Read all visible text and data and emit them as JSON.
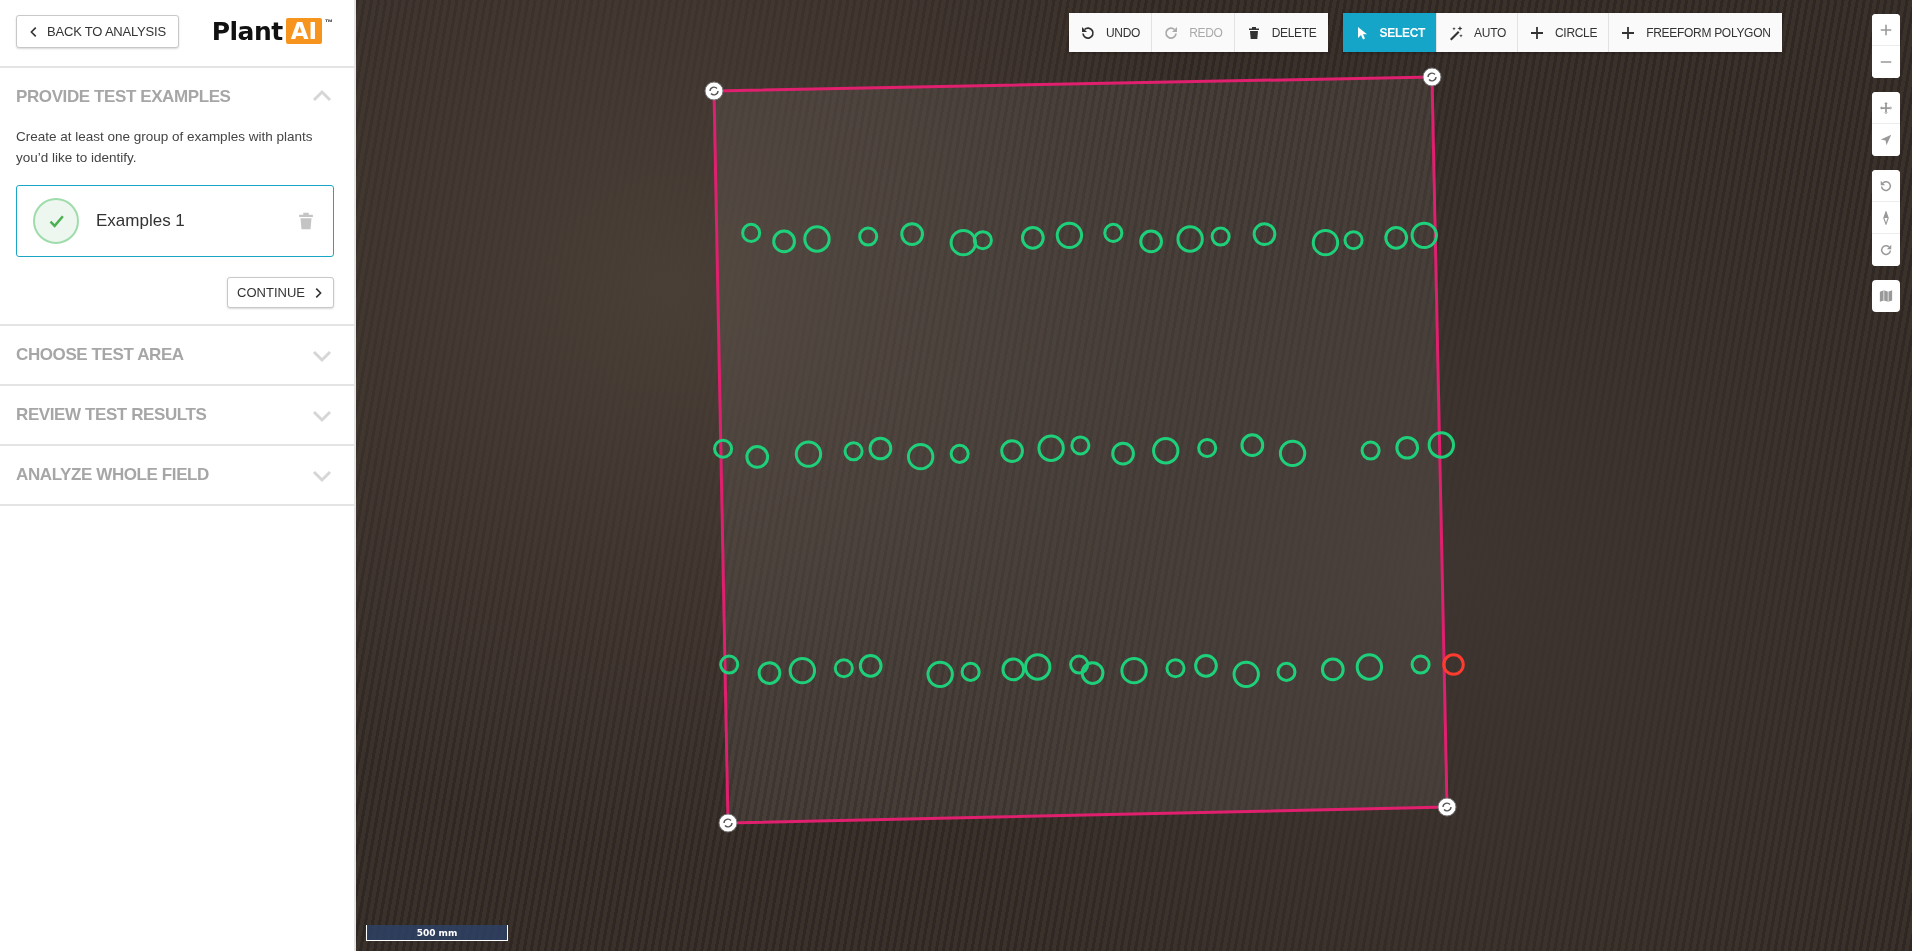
{
  "back_button": {
    "label": "BACK TO ANALYSIS"
  },
  "logo": {
    "word": "Plant",
    "badge": "AI",
    "trademark": "™"
  },
  "steps": [
    {
      "title": "PROVIDE TEST EXAMPLES",
      "expanded": true,
      "description": "Create at least one group of examples with plants you’d like to identify.",
      "groups": [
        {
          "name": "Examples 1",
          "complete": true
        }
      ],
      "continue_label": "CONTINUE"
    },
    {
      "title": "CHOOSE TEST AREA",
      "expanded": false
    },
    {
      "title": "REVIEW TEST RESULTS",
      "expanded": false
    },
    {
      "title": "ANALYZE WHOLE FIELD",
      "expanded": false
    }
  ],
  "toolbar": {
    "actions": [
      {
        "kind": "undo",
        "label": "UNDO",
        "disabled": false
      },
      {
        "kind": "redo",
        "label": "REDO",
        "disabled": true
      },
      {
        "kind": "delete",
        "label": "DELETE",
        "disabled": false
      }
    ],
    "modes": [
      {
        "kind": "select",
        "label": "SELECT",
        "selected": true
      },
      {
        "kind": "auto",
        "label": "AUTO",
        "selected": false
      },
      {
        "kind": "circle",
        "label": "CIRCLE",
        "selected": false
      },
      {
        "kind": "polygon",
        "label": "FREEFORM POLYGON",
        "selected": false
      }
    ]
  },
  "scale_bar": {
    "label": "500 mm"
  }
}
